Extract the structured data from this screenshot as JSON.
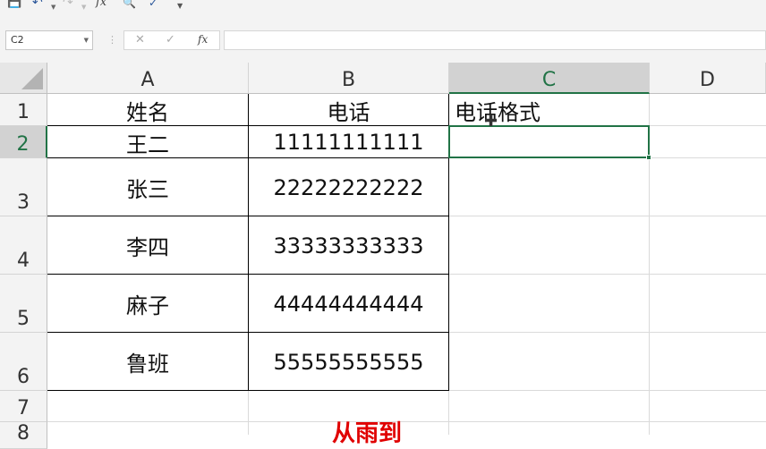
{
  "toolbar": {
    "save_icon": "save-icon",
    "undo_icon": "undo-icon",
    "redo_icon": "redo-icon",
    "fx_label": "fx"
  },
  "formula_bar": {
    "name_box": "C2",
    "insert_function_label": "fx",
    "formula_value": ""
  },
  "columns": [
    "A",
    "B",
    "C",
    "D"
  ],
  "rows": [
    "1",
    "2",
    "3",
    "4",
    "5",
    "6",
    "7",
    "8"
  ],
  "cells": {
    "A1": "姓名",
    "B1": "电话",
    "C1": "电话格式",
    "A2": "王二",
    "B2": "11111111111",
    "A3": "张三",
    "B3": "22222222222",
    "A4": "李四",
    "B4": "33333333333",
    "A5": "麻子",
    "B5": "44444444444",
    "A6": "鲁班",
    "B6": "55555555555"
  },
  "selected_cell": "C2",
  "caption_partial": "从雨到",
  "colors": {
    "accent": "#217346",
    "caption": "#e00000"
  }
}
